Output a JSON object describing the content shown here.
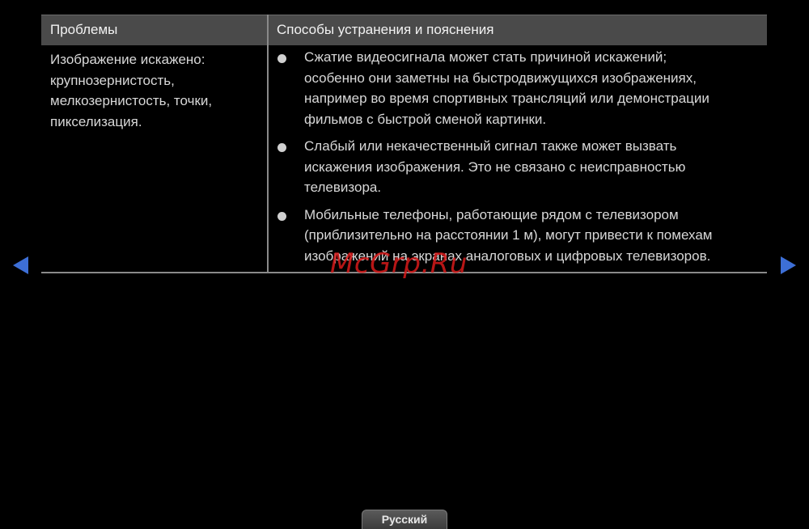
{
  "table": {
    "headers": [
      "Проблемы",
      "Способы устранения и пояснения"
    ],
    "rows": [
      {
        "problem": "Изображение искажено: крупнозернистость, мелкозернистость, точки, пикселизация.",
        "problem_lines": [
          "Изображение искажено:",
          "крупнозернистость,",
          "мелкозернистость, точки,",
          "пикселизация."
        ],
        "solutions": [
          {
            "lines": [
              "Сжатие видеосигнала может стать причиной искажений;",
              "особенно они заметны на быстродвижущихся изображениях,",
              "например во время спортивных трансляций или демонстрации",
              "фильмов с быстрой сменой картинки."
            ]
          },
          {
            "lines": [
              "Слабый или некачественный сигнал также может вызвать",
              "искажения изображения. Это не связано с неисправностью",
              "телевизора."
            ]
          },
          {
            "lines": [
              "Мобильные телефоны, работающие рядом с телевизором",
              "(приблизительно на расстоянии 1 м), могут привести к помехам",
              "изображений на экранах аналоговых и цифровых телевизоров."
            ]
          }
        ]
      }
    ]
  },
  "navigation": {
    "prev_icon": "triangle-left-icon",
    "next_icon": "triangle-right-icon",
    "arrow_color": "#3d6fd6"
  },
  "watermark": "McGrp.Ru",
  "language_button": "Русский"
}
